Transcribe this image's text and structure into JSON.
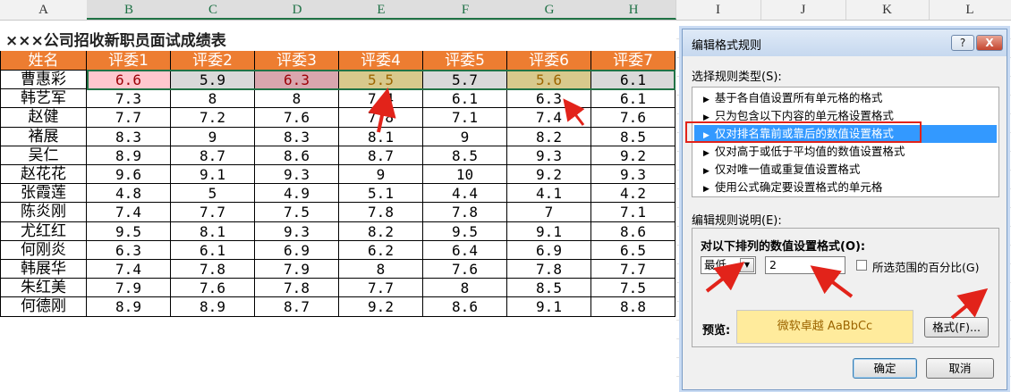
{
  "sheet": {
    "columns": [
      "A",
      "B",
      "C",
      "D",
      "E",
      "F",
      "G",
      "H",
      "I",
      "J",
      "K",
      "L"
    ],
    "title": "×××公司招收新职员面试成绩表",
    "header": [
      "姓名",
      "评委1",
      "评委2",
      "评委3",
      "评委4",
      "评委5",
      "评委6",
      "评委7"
    ],
    "rows": [
      {
        "name": "曹惠彩",
        "scores": [
          "6.6",
          "5.9",
          "6.3",
          "5.5",
          "5.7",
          "5.6",
          "6.1"
        ]
      },
      {
        "name": "韩艺军",
        "scores": [
          "7.3",
          "8",
          "8",
          "7.4",
          "6.1",
          "6.3",
          "6.1"
        ]
      },
      {
        "name": "赵健",
        "scores": [
          "7.7",
          "7.2",
          "7.6",
          "7.8",
          "7.1",
          "7.4",
          "7.6"
        ]
      },
      {
        "name": "褚展",
        "scores": [
          "8.3",
          "9",
          "8.3",
          "8.1",
          "9",
          "8.2",
          "8.5"
        ]
      },
      {
        "name": "吴仁",
        "scores": [
          "8.9",
          "8.7",
          "8.6",
          "8.7",
          "8.5",
          "9.3",
          "9.2"
        ]
      },
      {
        "name": "赵花花",
        "scores": [
          "9.6",
          "9.1",
          "9.3",
          "9",
          "10",
          "9.2",
          "9.3"
        ]
      },
      {
        "name": "张霞莲",
        "scores": [
          "4.8",
          "5",
          "4.9",
          "5.1",
          "4.4",
          "4.1",
          "4.2"
        ]
      },
      {
        "name": "陈炎刚",
        "scores": [
          "7.4",
          "7.7",
          "7.5",
          "7.8",
          "7.8",
          "7",
          "7.1"
        ]
      },
      {
        "name": "尤红红",
        "scores": [
          "9.5",
          "8.1",
          "9.3",
          "8.2",
          "9.5",
          "9.1",
          "8.6"
        ]
      },
      {
        "name": "何刚炎",
        "scores": [
          "6.3",
          "6.1",
          "6.9",
          "6.2",
          "6.4",
          "6.9",
          "6.5"
        ]
      },
      {
        "name": "韩展华",
        "scores": [
          "7.4",
          "7.8",
          "7.9",
          "8",
          "7.6",
          "7.8",
          "7.7"
        ]
      },
      {
        "name": "朱红美",
        "scores": [
          "7.9",
          "7.6",
          "7.8",
          "7.7",
          "8",
          "8.5",
          "7.5"
        ]
      },
      {
        "name": "何德刚",
        "scores": [
          "8.9",
          "8.9",
          "8.7",
          "9.2",
          "8.6",
          "9.1",
          "8.8"
        ]
      }
    ],
    "colors": {
      "header_bg": "#ed7d31",
      "first_row_fills": [
        "#ffc7ce",
        "#d9d9d9",
        "#d9a6ae",
        "#d8c98c",
        "#d9d9d9",
        "#d8c98c",
        "#d9d9d9"
      ],
      "first_row_text": [
        "#9c0006",
        "#000000",
        "#9c0006",
        "#9c6500",
        "#000000",
        "#9c6500",
        "#000000"
      ]
    }
  },
  "dialog": {
    "title": "编辑格式规则",
    "help_label": "?",
    "close_label": "X",
    "rule_type_label": "选择规则类型(S):",
    "rule_types": [
      "基于各自值设置所有单元格的格式",
      "只为包含以下内容的单元格设置格式",
      "仅对排名靠前或靠后的数值设置格式",
      "仅对高于或低于平均值的数值设置格式",
      "仅对唯一值或重复值设置格式",
      "使用公式确定要设置格式的单元格"
    ],
    "selected_rule_index": 2,
    "edit_desc_label": "编辑规则说明(E):",
    "format_values_label": "对以下排列的数值设置格式(O):",
    "rank_select_value": "最低",
    "rank_number_value": "2",
    "percent_label": "所选范围的百分比(G)",
    "preview_label": "预览:",
    "preview_sample": "微软卓越  AaBbCc",
    "format_button": "格式(F)...",
    "ok_button": "确定",
    "cancel_button": "取消"
  }
}
